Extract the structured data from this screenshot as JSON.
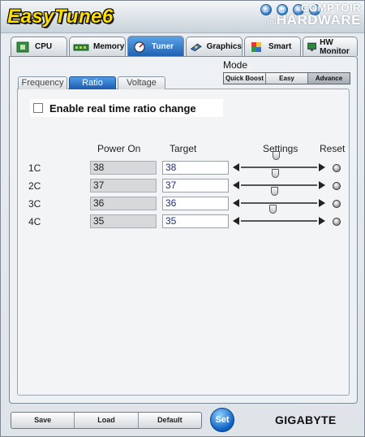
{
  "app": {
    "title": "EasyTune6"
  },
  "titlebar": {
    "buttons": [
      {
        "name": "home",
        "glyph": "⌂"
      },
      {
        "name": "about",
        "glyph": "@"
      },
      {
        "name": "minimize",
        "glyph": "–"
      },
      {
        "name": "close",
        "glyph": "×"
      }
    ],
    "watermark_line1": "COMPTOIR",
    "watermark_line2_prefix": "du",
    "watermark_line2": "HARDWARE"
  },
  "main_tabs": [
    {
      "label": "CPU",
      "icon": "cpu-chip-icon",
      "active": false
    },
    {
      "label": "Memory",
      "icon": "memory-module-icon",
      "active": false
    },
    {
      "label": "Tuner",
      "icon": "gauge-icon",
      "active": true
    },
    {
      "label": "Graphics",
      "icon": "graphics-card-icon",
      "active": false
    },
    {
      "label": "Smart",
      "icon": "smart-cube-icon",
      "active": false
    },
    {
      "label": "HW Monitor",
      "icon": "monitor-icon",
      "active": false
    }
  ],
  "mode": {
    "label": "Mode",
    "options": [
      "Quick Boost",
      "Easy",
      "Advance"
    ],
    "selected": "Advance"
  },
  "sub_tabs": [
    {
      "label": "Frequency",
      "active": false
    },
    {
      "label": "Ratio",
      "active": true
    },
    {
      "label": "Voltage",
      "active": false
    }
  ],
  "ratio": {
    "enable_realtime_label": "Enable real time ratio change",
    "enable_realtime_checked": false,
    "headers": {
      "power_on": "Power On",
      "target": "Target",
      "settings": "Settings",
      "reset": "Reset"
    },
    "rows": [
      {
        "label": "1C",
        "power_on": "38",
        "target": "38",
        "slider_fraction": 0.47
      },
      {
        "label": "2C",
        "power_on": "37",
        "target": "37",
        "slider_fraction": 0.46
      },
      {
        "label": "3C",
        "power_on": "36",
        "target": "36",
        "slider_fraction": 0.45
      },
      {
        "label": "4C",
        "power_on": "35",
        "target": "35",
        "slider_fraction": 0.43
      }
    ]
  },
  "bottom": {
    "save_label": "Save",
    "load_label": "Load",
    "default_label": "Default",
    "set_label": "Set",
    "brand": "GIGABYTE"
  },
  "colors": {
    "accent": "#1d5fb0",
    "logo": "#ffde00",
    "target_text": "#1b2e8c"
  }
}
